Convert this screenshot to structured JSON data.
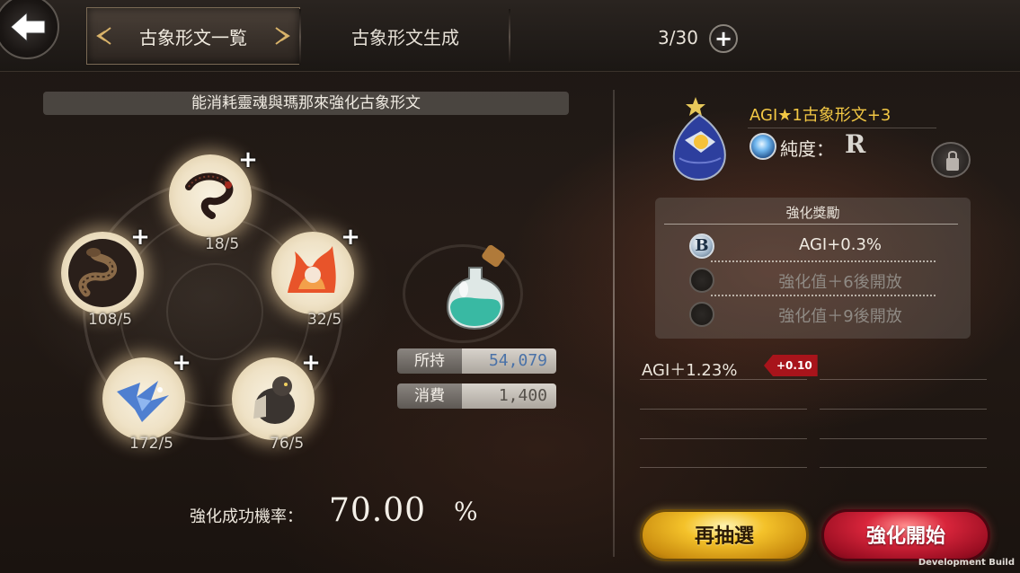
{
  "header": {
    "tabs": [
      {
        "label": "古象形文一覧",
        "active": true
      },
      {
        "label": "古象形文生成",
        "active": false
      }
    ],
    "count": "3/30"
  },
  "left_panel": {
    "instruction": "能消耗靈魂與瑪那來強化古象形文",
    "souls": [
      {
        "count": "18/5",
        "creature": "black-serpent-dragon"
      },
      {
        "count": "108/5",
        "creature": "coiled-serpent"
      },
      {
        "count": "32/5",
        "creature": "fire-fox"
      },
      {
        "count": "172/5",
        "creature": "blue-wyvern"
      },
      {
        "count": "76/5",
        "creature": "armored-bear"
      }
    ],
    "held_label": "所持",
    "held_value": "54,079",
    "cost_label": "消費",
    "cost_value": "1,400",
    "success_rate_label": "強化成功機率：",
    "success_rate_value": "70.00",
    "success_rate_unit": "%"
  },
  "right_panel": {
    "rune_name": "AGI★1古象形文+3",
    "purity_label": "純度：",
    "purity_grade": "R",
    "reward_title": "強化獎勵",
    "rewards": [
      {
        "icon": "B",
        "text": "AGI+0.3%",
        "unlocked": true
      },
      {
        "icon": "",
        "text": "強化值＋6後開放",
        "unlocked": false
      },
      {
        "icon": "",
        "text": "強化值＋9後開放",
        "unlocked": false
      }
    ],
    "stat_text": "AGI＋1.23%",
    "stat_delta": "+0.10"
  },
  "buttons": {
    "redraw": "再抽選",
    "enhance": "強化開始"
  },
  "footer": {
    "dev_build": "Development Build"
  },
  "colors": {
    "rune_name": "#f2c744",
    "held_value": "#4a72a8",
    "delta_badge": "#a8141b",
    "redraw_button": "#f4c22a",
    "enhance_button": "#d8253b"
  }
}
